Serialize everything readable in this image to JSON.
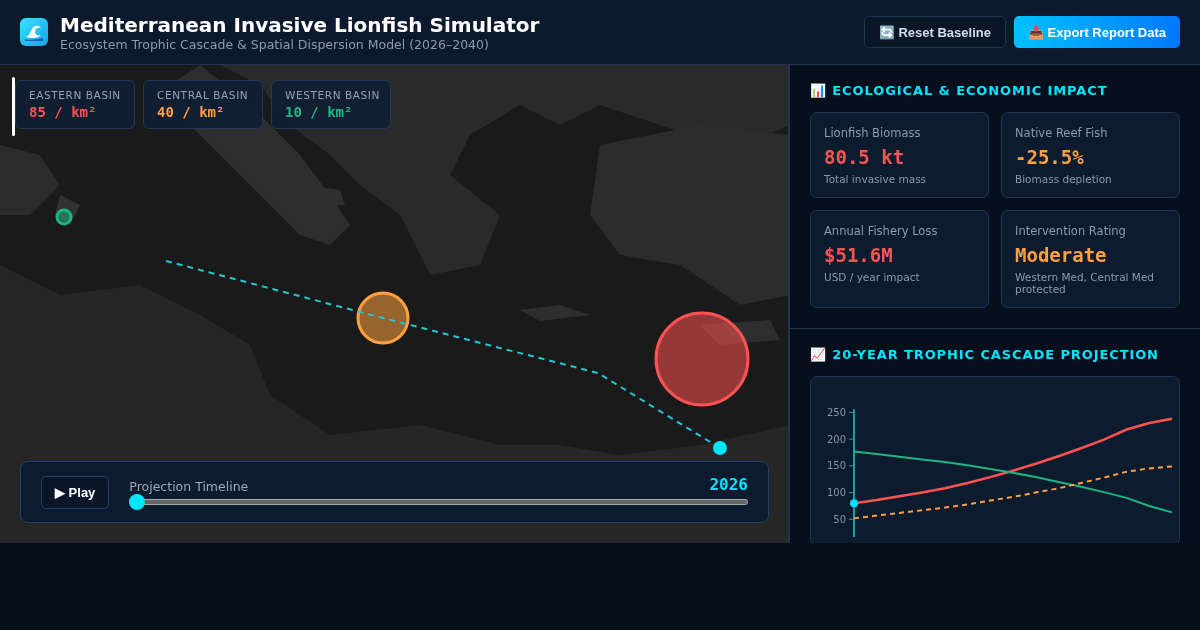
{
  "header": {
    "title": "Mediterranean Invasive Lionfish Simulator",
    "subtitle": "Ecosystem Trophic Cascade & Spatial Dispersion Model (2026–2040)",
    "buttons": [
      {
        "label": "Reset Baseline",
        "kind": "secondary",
        "icon": "🔄"
      },
      {
        "label": "Export Report Data",
        "kind": "primary",
        "icon": "📥"
      }
    ]
  },
  "map": {
    "basins": [
      {
        "label": "EASTERN BASIN",
        "density": "85 / km²",
        "color": "#ff5252"
      },
      {
        "label": "CENTRAL BASIN",
        "density": "40 / km²",
        "color": "#ffa040"
      },
      {
        "label": "WESTERN BASIN",
        "density": "10 / km²",
        "color": "#1db584"
      }
    ],
    "hotspots": [
      {
        "color": "#1db584"
      },
      {
        "color": "#ffa040"
      },
      {
        "color": "#ff5252"
      }
    ],
    "timeline": {
      "button": "▶ Play",
      "label": "Projection Timeline",
      "year": "2026",
      "level": 0
    }
  },
  "impact": {
    "title": "ECOLOGICAL & ECONOMIC IMPACT",
    "icon": "📊",
    "cards": [
      {
        "label": "Lionfish Biomass",
        "value": "80.5 kt",
        "note": "Total invasive mass",
        "color": "#ff5252"
      },
      {
        "label": "Native Reef Fish",
        "value": "-25.5%",
        "note": "Biomass depletion",
        "color": "#ffa040"
      },
      {
        "label": "Annual Fishery Loss",
        "value": "$51.6M",
        "note": "USD / year impact",
        "color": "#ff5252"
      },
      {
        "label": "Intervention Rating",
        "value": "Moderate",
        "note": "Western Med, Central Med protected",
        "color": "#ffa040"
      }
    ]
  },
  "projection": {
    "title": "20-YEAR TROPHIC CASCADE PROJECTION",
    "icon": "📈",
    "chart_data": {
      "type": "line",
      "ylim": [
        17,
        260
      ],
      "yticks": [
        50,
        100,
        150,
        200,
        250
      ],
      "series": [
        {
          "color": "#ff5252",
          "line_style": "solid",
          "values": [
            80,
            86,
            93,
            100,
            108,
            118,
            129,
            141,
            154,
            168,
            183,
            199,
            218,
            230,
            238
          ]
        },
        {
          "color": "#1db584",
          "line_style": "solid",
          "values": [
            177,
            172,
            167,
            162,
            157,
            151,
            144,
            137,
            129,
            120,
            111,
            101,
            90,
            75,
            63
          ]
        },
        {
          "color": "#ffa040",
          "line_style": "dashed",
          "values": [
            52,
            57,
            62,
            67,
            72,
            78,
            85,
            92,
            100,
            108,
            118,
            128,
            139,
            145,
            149
          ]
        }
      ]
    }
  }
}
